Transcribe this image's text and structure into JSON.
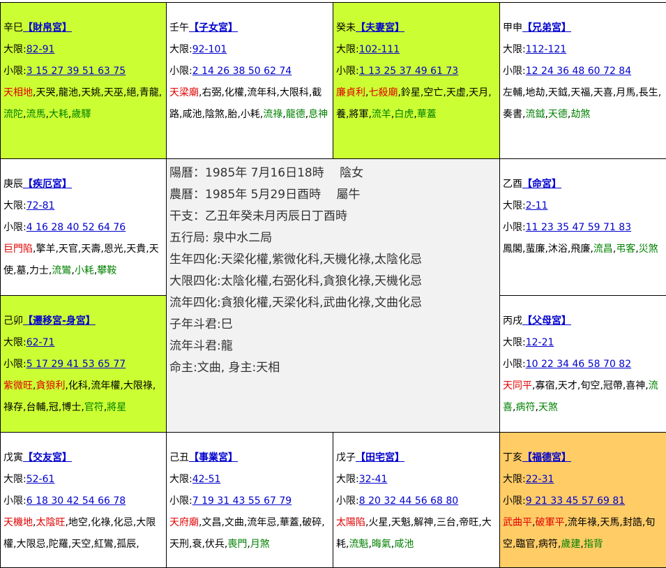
{
  "palaces": [
    {
      "id": "p0",
      "stem_branch": "辛巳",
      "name": "【財帛宮】",
      "big_label": "大限",
      "big_range": "82-91",
      "small_label": "小限",
      "small_years": "3 15 27 39 51 63 75",
      "bg": "#ccff33",
      "stars": [
        {
          "t": "天相地",
          "c": "red"
        },
        {
          "t": ",",
          "c": "black"
        },
        {
          "t": "天哭",
          "c": "black"
        },
        {
          "t": ",",
          "c": "black"
        },
        {
          "t": "龍池",
          "c": "black"
        },
        {
          "t": ",",
          "c": "black"
        },
        {
          "t": "天姚",
          "c": "black"
        },
        {
          "t": ",",
          "c": "black"
        },
        {
          "t": "天巫",
          "c": "black"
        },
        {
          "t": ",",
          "c": "black"
        },
        {
          "t": "絕",
          "c": "black"
        },
        {
          "t": ",",
          "c": "black"
        },
        {
          "t": "青龍",
          "c": "black"
        },
        {
          "t": ",",
          "c": "black"
        },
        {
          "t": "流陀",
          "c": "green"
        },
        {
          "t": ",",
          "c": "black"
        },
        {
          "t": "流馬",
          "c": "green"
        },
        {
          "t": ",",
          "c": "black"
        },
        {
          "t": "大耗",
          "c": "green"
        },
        {
          "t": ",",
          "c": "black"
        },
        {
          "t": "歲驛",
          "c": "green"
        }
      ]
    },
    {
      "id": "p1",
      "stem_branch": "壬午",
      "name": "【子女宮】",
      "big_label": "大限",
      "big_range": "92-101",
      "small_label": "小限",
      "small_years": "2 14 26 38 50 62 74",
      "bg": "#ffffff",
      "stars": [
        {
          "t": "天梁廟",
          "c": "red"
        },
        {
          "t": ",",
          "c": "black"
        },
        {
          "t": "右弼",
          "c": "black"
        },
        {
          "t": ",",
          "c": "black"
        },
        {
          "t": "化權",
          "c": "black"
        },
        {
          "t": ",",
          "c": "black"
        },
        {
          "t": "流年科",
          "c": "black"
        },
        {
          "t": ",",
          "c": "black"
        },
        {
          "t": "大限科",
          "c": "black"
        },
        {
          "t": ",",
          "c": "black"
        },
        {
          "t": "截路",
          "c": "black"
        },
        {
          "t": ",",
          "c": "black"
        },
        {
          "t": "咸池",
          "c": "black"
        },
        {
          "t": ",",
          "c": "black"
        },
        {
          "t": "陰煞",
          "c": "black"
        },
        {
          "t": ",",
          "c": "black"
        },
        {
          "t": "胎",
          "c": "black"
        },
        {
          "t": ",",
          "c": "black"
        },
        {
          "t": "小耗",
          "c": "black"
        },
        {
          "t": ",",
          "c": "black"
        },
        {
          "t": "流祿",
          "c": "green"
        },
        {
          "t": ",",
          "c": "black"
        },
        {
          "t": "龍德",
          "c": "green"
        },
        {
          "t": ",",
          "c": "black"
        },
        {
          "t": "息神",
          "c": "green"
        }
      ]
    },
    {
      "id": "p2",
      "stem_branch": "癸未",
      "name": "【夫妻宮】",
      "big_label": "大限",
      "big_range": "102-111",
      "small_label": "小限",
      "small_years": "1 13 25 37 49 61 73",
      "bg": "#ccff33",
      "stars": [
        {
          "t": "廉貞利",
          "c": "red"
        },
        {
          "t": ",",
          "c": "black"
        },
        {
          "t": "七殺廟",
          "c": "red"
        },
        {
          "t": ",",
          "c": "black"
        },
        {
          "t": "鈴星",
          "c": "black"
        },
        {
          "t": ",",
          "c": "black"
        },
        {
          "t": "空亡",
          "c": "black"
        },
        {
          "t": ",",
          "c": "black"
        },
        {
          "t": "天虛",
          "c": "black"
        },
        {
          "t": ",",
          "c": "black"
        },
        {
          "t": "天月",
          "c": "black"
        },
        {
          "t": ",",
          "c": "black"
        },
        {
          "t": "養",
          "c": "black"
        },
        {
          "t": ",",
          "c": "black"
        },
        {
          "t": "將軍",
          "c": "black"
        },
        {
          "t": ",",
          "c": "black"
        },
        {
          "t": "流羊",
          "c": "green"
        },
        {
          "t": ",",
          "c": "black"
        },
        {
          "t": "白虎",
          "c": "green"
        },
        {
          "t": ",",
          "c": "black"
        },
        {
          "t": "華蓋",
          "c": "green"
        }
      ]
    },
    {
      "id": "p3",
      "stem_branch": "甲申",
      "name": "【兄弟宮】",
      "big_label": "大限",
      "big_range": "112-121",
      "small_label": "小限",
      "small_years": "12 24 36 48 60 72 84",
      "bg": "#ffffff",
      "stars": [
        {
          "t": "左輔",
          "c": "black"
        },
        {
          "t": ",",
          "c": "black"
        },
        {
          "t": "地劫",
          "c": "black"
        },
        {
          "t": ",",
          "c": "black"
        },
        {
          "t": "天鉞",
          "c": "black"
        },
        {
          "t": ",",
          "c": "black"
        },
        {
          "t": "天福",
          "c": "black"
        },
        {
          "t": ",",
          "c": "black"
        },
        {
          "t": "天喜",
          "c": "black"
        },
        {
          "t": ",",
          "c": "black"
        },
        {
          "t": "月馬",
          "c": "black"
        },
        {
          "t": ",",
          "c": "black"
        },
        {
          "t": "長生",
          "c": "black"
        },
        {
          "t": ",",
          "c": "black"
        },
        {
          "t": "奏書",
          "c": "black"
        },
        {
          "t": ",",
          "c": "black"
        },
        {
          "t": "流鉞",
          "c": "green"
        },
        {
          "t": ",",
          "c": "black"
        },
        {
          "t": "天德",
          "c": "green"
        },
        {
          "t": ",",
          "c": "black"
        },
        {
          "t": "劫煞",
          "c": "green"
        }
      ]
    },
    {
      "id": "p4",
      "stem_branch": "庚辰",
      "name": "【疾厄宮】",
      "big_label": "大限",
      "big_range": "72-81",
      "small_label": "小限",
      "small_years": "4 16 28 40 52 64 76",
      "bg": "#ffffff",
      "stars": [
        {
          "t": "巨門陷",
          "c": "red"
        },
        {
          "t": ",",
          "c": "black"
        },
        {
          "t": "擎羊",
          "c": "black"
        },
        {
          "t": ",",
          "c": "black"
        },
        {
          "t": "天官",
          "c": "black"
        },
        {
          "t": ",",
          "c": "black"
        },
        {
          "t": "天壽",
          "c": "black"
        },
        {
          "t": ",",
          "c": "black"
        },
        {
          "t": "恩光",
          "c": "black"
        },
        {
          "t": ",",
          "c": "black"
        },
        {
          "t": "天貴",
          "c": "black"
        },
        {
          "t": ",",
          "c": "black"
        },
        {
          "t": "天使",
          "c": "black"
        },
        {
          "t": ",",
          "c": "black"
        },
        {
          "t": "墓",
          "c": "black"
        },
        {
          "t": ",",
          "c": "black"
        },
        {
          "t": "力士",
          "c": "black"
        },
        {
          "t": ",",
          "c": "black"
        },
        {
          "t": "流鸞",
          "c": "green"
        },
        {
          "t": ",",
          "c": "black"
        },
        {
          "t": "小耗",
          "c": "green"
        },
        {
          "t": ",",
          "c": "black"
        },
        {
          "t": "攀鞍",
          "c": "green"
        }
      ]
    },
    {
      "id": "p5",
      "stem_branch": "乙酉",
      "name": "【命宮】",
      "big_label": "大限",
      "big_range": "2-11",
      "small_label": "小限",
      "small_years": "11 23 35 47 59 71 83",
      "bg": "#ffffff",
      "stars": [
        {
          "t": "鳳閣",
          "c": "black"
        },
        {
          "t": ",",
          "c": "black"
        },
        {
          "t": "蜚廉",
          "c": "black"
        },
        {
          "t": ",",
          "c": "black"
        },
        {
          "t": "沐浴",
          "c": "black"
        },
        {
          "t": ",",
          "c": "black"
        },
        {
          "t": "飛廉",
          "c": "black"
        },
        {
          "t": ",",
          "c": "black"
        },
        {
          "t": "流昌",
          "c": "green"
        },
        {
          "t": ",",
          "c": "black"
        },
        {
          "t": "弔客",
          "c": "green"
        },
        {
          "t": ",",
          "c": "black"
        },
        {
          "t": "災煞",
          "c": "green"
        }
      ]
    },
    {
      "id": "p6",
      "stem_branch": "己卯",
      "name": "【遷移宮-身宮】",
      "big_label": "大限",
      "big_range": "62-71",
      "small_label": "小限",
      "small_years": "5 17 29 41 53 65 77",
      "bg": "#ccff33",
      "stars": [
        {
          "t": "紫微旺",
          "c": "red"
        },
        {
          "t": ",",
          "c": "black"
        },
        {
          "t": "貪狼利",
          "c": "red"
        },
        {
          "t": ",",
          "c": "black"
        },
        {
          "t": "化科",
          "c": "black"
        },
        {
          "t": ",",
          "c": "black"
        },
        {
          "t": "流年權",
          "c": "black"
        },
        {
          "t": ",",
          "c": "black"
        },
        {
          "t": "大限祿",
          "c": "black"
        },
        {
          "t": ",",
          "c": "black"
        },
        {
          "t": "祿存",
          "c": "black"
        },
        {
          "t": ",",
          "c": "black"
        },
        {
          "t": "台輔",
          "c": "black"
        },
        {
          "t": ",",
          "c": "black"
        },
        {
          "t": "冠",
          "c": "black"
        },
        {
          "t": ",",
          "c": "black"
        },
        {
          "t": "博士",
          "c": "black"
        },
        {
          "t": ",",
          "c": "black"
        },
        {
          "t": "官符",
          "c": "green"
        },
        {
          "t": ",",
          "c": "black"
        },
        {
          "t": "將星",
          "c": "green"
        }
      ]
    },
    {
      "id": "p7",
      "stem_branch": "丙戌",
      "name": "【父母宮】",
      "big_label": "大限",
      "big_range": "12-21",
      "small_label": "小限",
      "small_years": "10 22 34 46 58 70 82",
      "bg": "#ffffff",
      "stars": [
        {
          "t": "天同平",
          "c": "red"
        },
        {
          "t": ",",
          "c": "black"
        },
        {
          "t": "寡宿",
          "c": "black"
        },
        {
          "t": ",",
          "c": "black"
        },
        {
          "t": "天才",
          "c": "black"
        },
        {
          "t": ",",
          "c": "black"
        },
        {
          "t": "旬空",
          "c": "black"
        },
        {
          "t": ",",
          "c": "black"
        },
        {
          "t": "冠帶",
          "c": "black"
        },
        {
          "t": ",",
          "c": "black"
        },
        {
          "t": "喜神",
          "c": "black"
        },
        {
          "t": ",",
          "c": "black"
        },
        {
          "t": "流喜",
          "c": "green"
        },
        {
          "t": ",",
          "c": "black"
        },
        {
          "t": "病符",
          "c": "green"
        },
        {
          "t": ",",
          "c": "black"
        },
        {
          "t": "天煞",
          "c": "green"
        }
      ]
    },
    {
      "id": "p8",
      "stem_branch": "戊寅",
      "name": "【交友宮】",
      "big_label": "大限",
      "big_range": "52-61",
      "small_label": "小限",
      "small_years": "6 18 30 42 54 66 78",
      "bg": "#ffffff",
      "stars": [
        {
          "t": "天機地",
          "c": "red"
        },
        {
          "t": ",",
          "c": "black"
        },
        {
          "t": "太陰旺",
          "c": "red"
        },
        {
          "t": ",",
          "c": "black"
        },
        {
          "t": "地空",
          "c": "black"
        },
        {
          "t": ",",
          "c": "black"
        },
        {
          "t": "化祿",
          "c": "black"
        },
        {
          "t": ",",
          "c": "black"
        },
        {
          "t": "化忌",
          "c": "black"
        },
        {
          "t": ",",
          "c": "black"
        },
        {
          "t": "大限權",
          "c": "black"
        },
        {
          "t": ",",
          "c": "black"
        },
        {
          "t": "大限忌",
          "c": "black"
        },
        {
          "t": ",",
          "c": "black"
        },
        {
          "t": "陀羅",
          "c": "black"
        },
        {
          "t": ",",
          "c": "black"
        },
        {
          "t": "天空",
          "c": "black"
        },
        {
          "t": ",",
          "c": "black"
        },
        {
          "t": "紅鸞",
          "c": "black"
        },
        {
          "t": ",",
          "c": "black"
        },
        {
          "t": "孤辰",
          "c": "black"
        },
        {
          "t": ",",
          "c": "black"
        }
      ]
    },
    {
      "id": "p9",
      "stem_branch": "己丑",
      "name": "【事業宮】",
      "big_label": "大限",
      "big_range": "42-51",
      "small_label": "小限",
      "small_years": "7 19 31 43 55 67 79",
      "bg": "#ffffff",
      "stars": [
        {
          "t": "天府廟",
          "c": "red"
        },
        {
          "t": ",",
          "c": "black"
        },
        {
          "t": "文昌",
          "c": "black"
        },
        {
          "t": ",",
          "c": "black"
        },
        {
          "t": "文曲",
          "c": "black"
        },
        {
          "t": ",",
          "c": "black"
        },
        {
          "t": "流年忌",
          "c": "black"
        },
        {
          "t": ",",
          "c": "black"
        },
        {
          "t": "華蓋",
          "c": "black"
        },
        {
          "t": ",",
          "c": "black"
        },
        {
          "t": "破碎",
          "c": "black"
        },
        {
          "t": ",",
          "c": "black"
        },
        {
          "t": "天刑",
          "c": "black"
        },
        {
          "t": ",",
          "c": "black"
        },
        {
          "t": "衰",
          "c": "black"
        },
        {
          "t": ",",
          "c": "black"
        },
        {
          "t": "伏兵",
          "c": "black"
        },
        {
          "t": ",",
          "c": "black"
        },
        {
          "t": "喪門",
          "c": "green"
        },
        {
          "t": ",",
          "c": "black"
        },
        {
          "t": "月煞",
          "c": "green"
        }
      ]
    },
    {
      "id": "p10",
      "stem_branch": "戊子",
      "name": "【田宅宮】",
      "big_label": "大限",
      "big_range": "32-41",
      "small_label": "小限",
      "small_years": "8 20 32 44 56 68 80",
      "bg": "#ffffff",
      "stars": [
        {
          "t": "太陽陷",
          "c": "red"
        },
        {
          "t": ",",
          "c": "black"
        },
        {
          "t": "火星",
          "c": "black"
        },
        {
          "t": ",",
          "c": "black"
        },
        {
          "t": "天魁",
          "c": "black"
        },
        {
          "t": ",",
          "c": "black"
        },
        {
          "t": "解神",
          "c": "black"
        },
        {
          "t": ",",
          "c": "black"
        },
        {
          "t": "三台",
          "c": "black"
        },
        {
          "t": ",",
          "c": "black"
        },
        {
          "t": "帝旺",
          "c": "black"
        },
        {
          "t": ",",
          "c": "black"
        },
        {
          "t": "大耗",
          "c": "black"
        },
        {
          "t": ",",
          "c": "black"
        },
        {
          "t": "流魁",
          "c": "green"
        },
        {
          "t": ",",
          "c": "black"
        },
        {
          "t": "晦氣",
          "c": "green"
        },
        {
          "t": ",",
          "c": "black"
        },
        {
          "t": "咸池",
          "c": "green"
        }
      ]
    },
    {
      "id": "p11",
      "stem_branch": "丁亥",
      "name": "【福德宮】",
      "big_label": "大限",
      "big_range": "22-31",
      "small_label": "小限",
      "small_years": "9 21 33 45 57 69 81",
      "bg": "#ffcc66",
      "stars": [
        {
          "t": "武曲平",
          "c": "red"
        },
        {
          "t": ",",
          "c": "black"
        },
        {
          "t": "破軍平",
          "c": "red"
        },
        {
          "t": ",",
          "c": "black"
        },
        {
          "t": "流年祿",
          "c": "black"
        },
        {
          "t": ",",
          "c": "black"
        },
        {
          "t": "天馬",
          "c": "black"
        },
        {
          "t": ",",
          "c": "black"
        },
        {
          "t": "封誥",
          "c": "black"
        },
        {
          "t": ",",
          "c": "black"
        },
        {
          "t": "旬空",
          "c": "black"
        },
        {
          "t": ",",
          "c": "black"
        },
        {
          "t": "臨官",
          "c": "black"
        },
        {
          "t": ",",
          "c": "black"
        },
        {
          "t": "病符",
          "c": "black"
        },
        {
          "t": ",",
          "c": "black"
        },
        {
          "t": "歲建",
          "c": "green"
        },
        {
          "t": ",",
          "c": "black"
        },
        {
          "t": "指背",
          "c": "green"
        }
      ]
    }
  ],
  "info": [
    "陽曆：1985年 7月16日18時　 陰女",
    "農曆：1985年 5月29日酉時　 屬牛",
    "干支：乙丑年癸未月丙辰日丁酉時",
    "五行局: 泉中水二局",
    "生年四化:天梁化權,紫微化科,天機化祿,太陰化忌",
    "大限四化:太陰化權,右弼化科,貪狼化祿,天機化忌",
    "流年四化:貪狼化權,天梁化科,武曲化祿,文曲化忌",
    "子年斗君:巳",
    "流年斗君:龍",
    "命主:文曲, 身主:天相"
  ]
}
